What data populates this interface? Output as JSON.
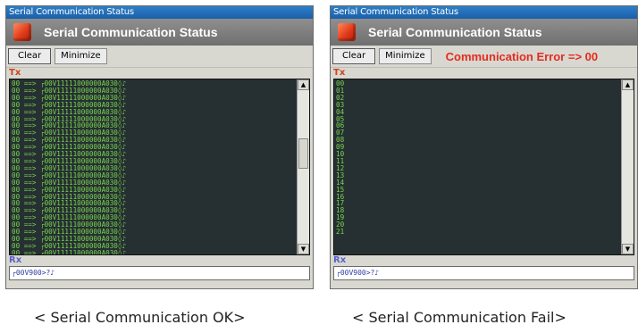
{
  "panels": {
    "ok": {
      "window_title": "Serial Communication Status",
      "header_title": "Serial Communication Status",
      "clear_label": "Clear",
      "minimize_label": "Minimize",
      "error_text": "",
      "tx_label": "Tx",
      "tx_lines": [
        "00 ==> ┌00V11111000000A030◊♪",
        "00 ==> ┌00V11111000000A030◊♪",
        "00 ==> ┌00V11111000000A030◊♪",
        "00 ==> ┌00V11111000000A030◊♪",
        "00 ==> ┌00V11111000000A030◊♪",
        "00 ==> ┌00V11111000000A030◊♪",
        "00 ==> ┌00V11111000000A030◊♪",
        "00 ==> ┌00V11111000000A030◊♪",
        "00 ==> ┌00V11111000000A030◊♪",
        "00 ==> ┌00V11111000000A030◊♪",
        "00 ==> ┌00V11111000000A030◊♪",
        "00 ==> ┌00V11111000000A030◊♪",
        "00 ==> ┌00V11111000000A030◊♪",
        "00 ==> ┌00V11111000000A030◊♪",
        "00 ==> ┌00V11111000000A030◊♪",
        "00 ==> ┌00V11111000000A030◊♪",
        "00 ==> ┌00V11111000000A030◊♪",
        "00 ==> ┌00V11111000000A030◊♪",
        "00 ==> ┌00V11111000000A030◊♪",
        "00 ==> ┌00V11111000000A030◊♪",
        "00 ==> ┌00V11111000000A030◊♪",
        "00 ==> ┌00V11111000000A030◊♪",
        "00 ==> ┌00V11111000000A030◊♪",
        "00 ==> ┌00V11111000000A030◊♪",
        "00 ==> ┌00V11111000000A030◊♪"
      ],
      "rx_label": "Rx",
      "rx_value": "┌00V900>?♪"
    },
    "fail": {
      "window_title": "Serial Communication Status",
      "header_title": "Serial Communication Status",
      "clear_label": "Clear",
      "minimize_label": "Minimize",
      "error_text": "Communication Error => 00",
      "tx_label": "Tx",
      "tx_lines": [
        "00",
        "01",
        "02",
        "03",
        "04",
        "05",
        "06",
        "07",
        "08",
        "09",
        "10",
        "11",
        "12",
        "13",
        "14",
        "15",
        "16",
        "17",
        "18",
        "19",
        "20",
        "21"
      ],
      "rx_label": "Rx",
      "rx_value": "┌00V900>?♪"
    }
  },
  "captions": {
    "ok": "< Serial Communication OK>",
    "fail": "< Serial Communication Fail>"
  },
  "icons": {
    "header_icon": "red-cube-icon",
    "scroll_up": "arrow-up-icon",
    "scroll_down": "arrow-down-icon"
  },
  "colors": {
    "console_text": "#7ad44f",
    "error_text": "#e52b20",
    "tx_label": "#d0421c",
    "rx_label": "#5a5fd0"
  }
}
